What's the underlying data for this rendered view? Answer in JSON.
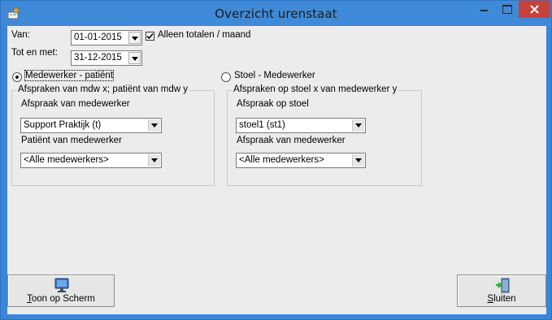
{
  "window": {
    "title": "Overzicht urenstaat"
  },
  "period": {
    "from_label": "Van:",
    "from_value": "01-01-2015",
    "to_label": "Tot en met:",
    "to_value": "31-12-2015",
    "totals_only_label": "Alleen totalen / maand",
    "totals_only_checked": true
  },
  "mode": {
    "option1_label": "Medewerker - patiënt",
    "option1_selected": true,
    "option2_label": "Stoel - Medewerker",
    "option2_selected": false
  },
  "group_left": {
    "legend": "Afspraken van mdw x; patiënt van mdw y",
    "field1_label": "Afspraak van medewerker",
    "field1_value": "Support Praktijk (t)",
    "field2_label": "Patiënt van medewerker",
    "field2_value": "<Alle medewerkers>"
  },
  "group_right": {
    "legend": "Afspraken op stoel x van medewerker y",
    "field1_label": "Afspraak op stoel",
    "field1_value": "stoel1 (st1)",
    "field2_label": "Afspraak van medewerker",
    "field2_value": "<Alle medewerkers>"
  },
  "buttons": {
    "show_first": "T",
    "show_rest": "oon op Scherm",
    "close_first": "S",
    "close_rest": "luiten"
  },
  "icons": {
    "app": "app-settings-icon",
    "show": "monitor-icon",
    "close": "exit-door-icon"
  },
  "colors": {
    "titlebar": "#3f8ad8",
    "close_button": "#c7413b",
    "client": "#ececec"
  }
}
